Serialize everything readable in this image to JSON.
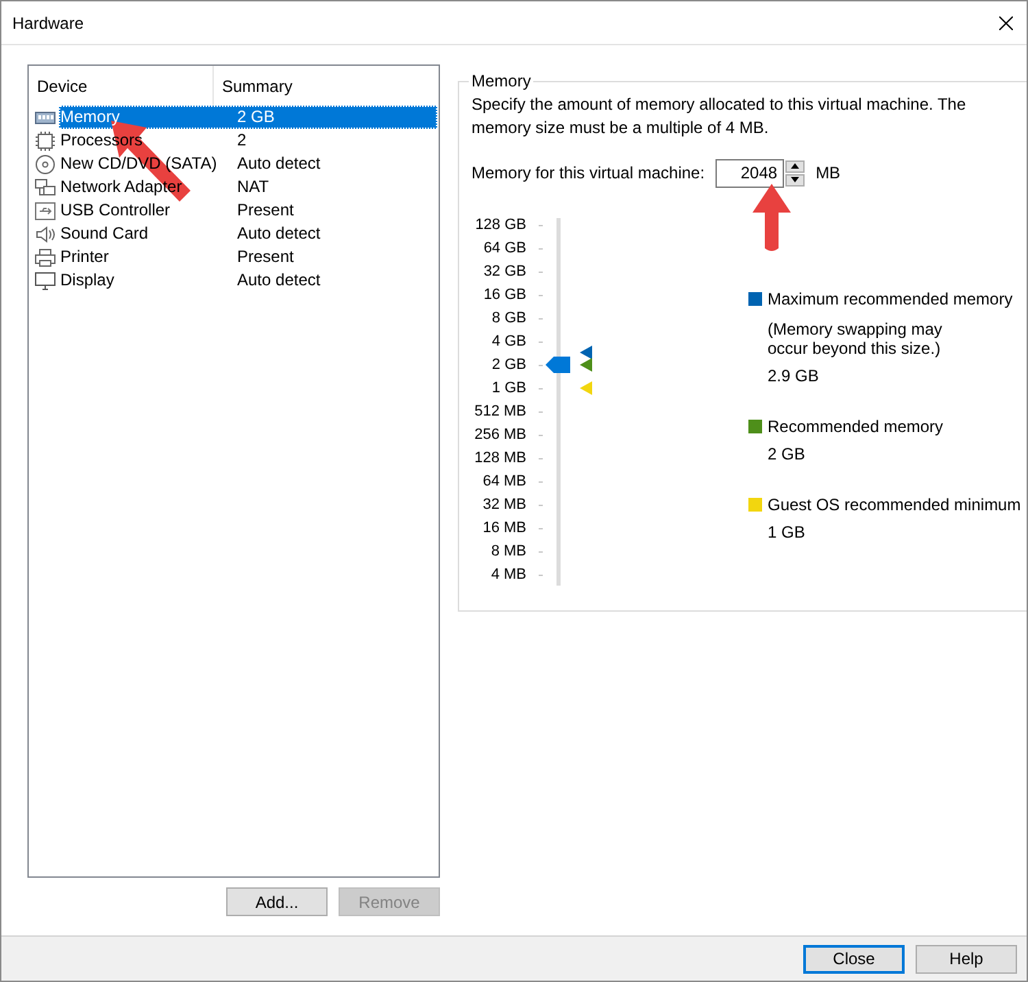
{
  "window": {
    "title": "Hardware"
  },
  "device_table": {
    "columns": [
      "Device",
      "Summary"
    ],
    "rows": [
      {
        "kind": "memory",
        "device": "Memory",
        "summary": "2 GB",
        "selected": true
      },
      {
        "kind": "processor",
        "device": "Processors",
        "summary": "2",
        "selected": false
      },
      {
        "kind": "cd",
        "device": "New CD/DVD (SATA)",
        "summary": "Auto detect",
        "selected": false
      },
      {
        "kind": "network",
        "device": "Network Adapter",
        "summary": "NAT",
        "selected": false
      },
      {
        "kind": "usb",
        "device": "USB Controller",
        "summary": "Present",
        "selected": false
      },
      {
        "kind": "sound",
        "device": "Sound Card",
        "summary": "Auto detect",
        "selected": false
      },
      {
        "kind": "printer",
        "device": "Printer",
        "summary": "Present",
        "selected": false
      },
      {
        "kind": "display",
        "device": "Display",
        "summary": "Auto detect",
        "selected": false
      }
    ]
  },
  "device_buttons": [
    {
      "label": "Add...",
      "disabled": false
    },
    {
      "label": "Remove",
      "disabled": true
    }
  ],
  "memory": {
    "title": "Memory",
    "description": "Specify the amount of memory allocated to this virtual machine. The memory size must be a multiple of 4 MB.",
    "field_label": "Memory for this virtual machine:",
    "value": "2048",
    "unit": "MB",
    "scale_labels": [
      "128 GB",
      "64 GB",
      "32 GB",
      "16 GB",
      "8 GB",
      "4 GB",
      "2 GB",
      "1 GB",
      "512 MB",
      "256 MB",
      "128 MB",
      "64 MB",
      "32 MB",
      "16 MB",
      "8 MB",
      "4 MB"
    ],
    "slider": {
      "level": 0.6
    },
    "legend": [
      {
        "color": "#0063b1",
        "label": "Maximum recommended memory",
        "note": "(Memory swapping may occur beyond this size.)",
        "value": "2.9 GB"
      },
      {
        "color": "#4e8f1a",
        "label": "Recommended memory",
        "value": "2 GB"
      },
      {
        "color": "#f2d60f",
        "label": "Guest OS recommended minimum",
        "value": "1 GB"
      }
    ]
  },
  "dialog_buttons": [
    {
      "label": "Close",
      "default": true
    },
    {
      "label": "Help",
      "default": false
    }
  ]
}
